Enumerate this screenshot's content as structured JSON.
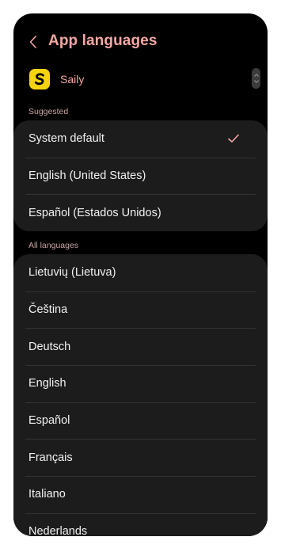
{
  "header": {
    "title": "App languages"
  },
  "app": {
    "name": "Saily",
    "logo_letter": "S"
  },
  "suggested": {
    "heading": "Suggested",
    "items": [
      {
        "label": "System default",
        "selected": true
      },
      {
        "label": "English (United States)",
        "selected": false
      },
      {
        "label": "Español (Estados Unidos)",
        "selected": false
      }
    ]
  },
  "all_languages": {
    "heading": "All languages",
    "items": [
      {
        "label": "Lietuvių (Lietuva)"
      },
      {
        "label": "Čeština"
      },
      {
        "label": "Deutsch"
      },
      {
        "label": "English"
      },
      {
        "label": "Español"
      },
      {
        "label": "Français"
      },
      {
        "label": "Italiano"
      },
      {
        "label": "Nederlands"
      }
    ]
  },
  "colors": {
    "accent": "#f5a7a3",
    "background": "#000000",
    "card": "#1c1c1c",
    "logo": "#f5d40f"
  },
  "icons": {
    "back": "chevron-left-icon",
    "check": "check-icon",
    "scroll": "fast-scroll-handle"
  }
}
